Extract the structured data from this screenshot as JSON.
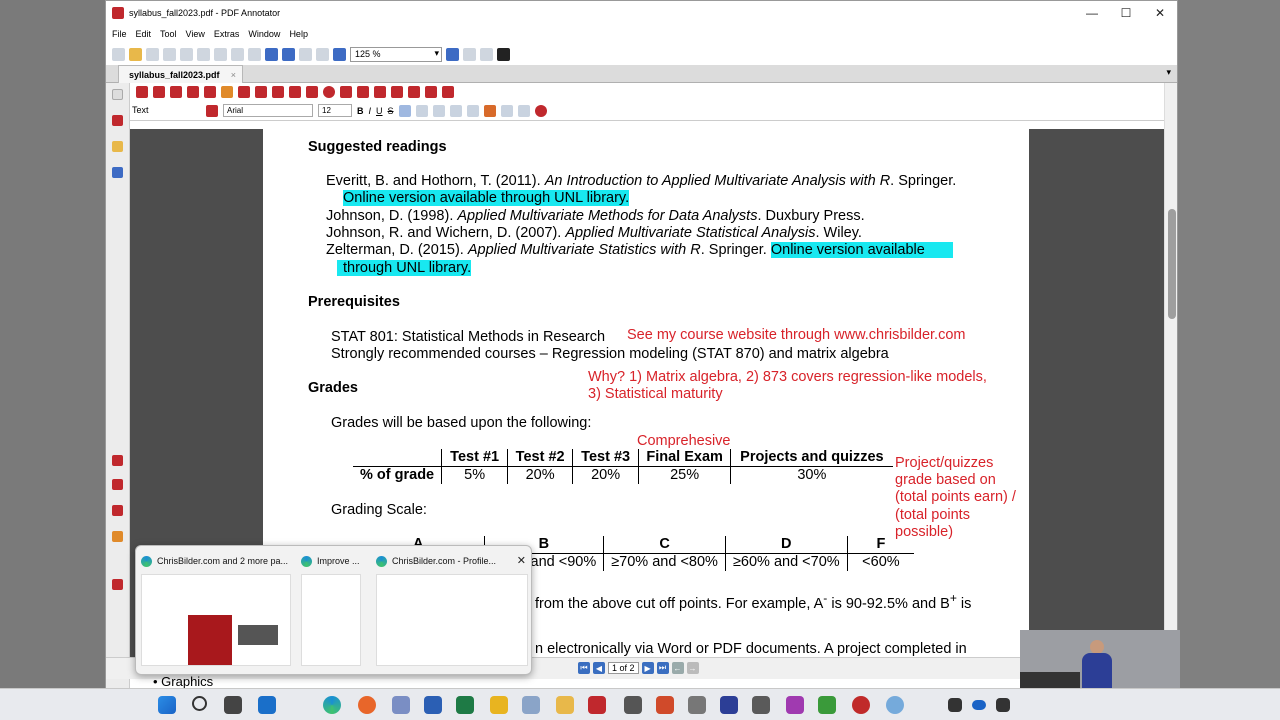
{
  "window": {
    "title": "syllabus_fall2023.pdf - PDF Annotator",
    "controls": {
      "minimize": "—",
      "maximize": "☐",
      "close": "✕"
    }
  },
  "menu": [
    "File",
    "Edit",
    "Tool",
    "View",
    "Extras",
    "Window",
    "Help"
  ],
  "toolbar": {
    "zoom": "125 %"
  },
  "tab": {
    "label": "syllabus_fall2023.pdf",
    "close": "×"
  },
  "format_toolbar": {
    "tool_label": "Text",
    "font": "Arial",
    "font_size": "12",
    "bold": "B",
    "italic": "I",
    "underline": "U",
    "strike": "S"
  },
  "document": {
    "readings_heading": "Suggested readings",
    "readings": [
      {
        "authors": "Everitt, B. and Hothorn, T. (2011). ",
        "title": "An Introduction to Applied Multivariate Analysis with R",
        "publisher": ". Springer."
      },
      {
        "authors": "Johnson, D. (1998). ",
        "title": "Applied Multivariate Methods for Data Analysts",
        "publisher": ". Duxbury Press."
      },
      {
        "authors": "Johnson, R. and Wichern, D. (2007). ",
        "title": "Applied Multivariate Statistical Analysis",
        "publisher": ". Wiley."
      },
      {
        "authors": "Zelterman, D. (2015). ",
        "title": "Applied Multivariate Statistics with R",
        "publisher": ". Springer."
      }
    ],
    "online_note_1": "Online version available through UNL library.",
    "online_note_2a": "Online version available",
    "online_note_2b": "through UNL library.",
    "prereq_heading": "Prerequisites",
    "prereq_1": "STAT 801: Statistical Methods in Research",
    "prereq_2": "Strongly recommended courses – Regression modeling (STAT 870) and matrix algebra",
    "grades_heading": "Grades",
    "grades_intro": "Grades will be based upon the following:",
    "grade_table": {
      "headers": [
        "",
        "Test #1",
        "Test #2",
        "Test #3",
        "Final Exam",
        "Projects and quizzes"
      ],
      "row_label": "% of grade",
      "values": [
        "5%",
        "20%",
        "20%",
        "25%",
        "30%"
      ]
    },
    "grading_scale_label": "Grading Scale:",
    "scale_headers": [
      "A",
      "B",
      "C",
      "D",
      "F"
    ],
    "scale_values": [
      "and <90%",
      "≥70% and <80%",
      "≥60% and <70%",
      "<60%"
    ],
    "cutoff_text": "from the above cut off points. For example, A",
    "cutoff_text2": " is 90-92.5% and B",
    "cutoff_text3": " is",
    "submit_text": "n electronically via Word or PDF documents. A project completed in",
    "graphics_text": "• Graphics"
  },
  "annotations": {
    "website": "See my course website through www.chrisbilder.com",
    "why_1": "Why? 1) Matrix algebra, 2) 873 covers regression-like models,",
    "why_2": "3) Statistical maturity",
    "comprehensive": "Comprehesive",
    "proj_1": "Project/quizzes",
    "proj_2": "grade based on",
    "proj_3": "(total points earn) /",
    "proj_4": "(total points",
    "proj_5": "possible)"
  },
  "statusbar": {
    "page": "1 of 2"
  },
  "taskbar_previews": [
    {
      "label": "ChrisBilder.com and 2 more pa..."
    },
    {
      "label": "Improve ..."
    },
    {
      "label": "ChrisBilder.com - Profile..."
    }
  ],
  "colors": {
    "highlight": "#18e8f0",
    "annotation": "#d8232a"
  }
}
